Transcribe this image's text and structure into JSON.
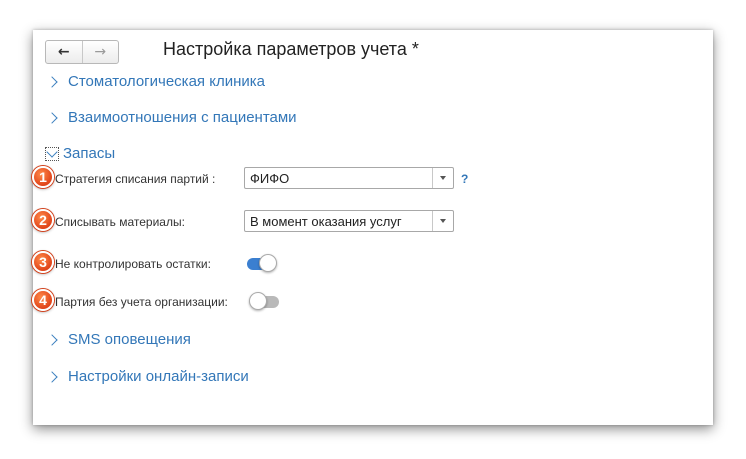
{
  "window": {
    "title": "Настройка параметров учета *"
  },
  "nav": {
    "back_icon": "←",
    "forward_icon": "→"
  },
  "groups": [
    {
      "label": "Стоматологическая клиника",
      "expanded": false
    },
    {
      "label": "Взаимоотношения с пациентами",
      "expanded": false
    },
    {
      "label": "Запасы",
      "expanded": true
    },
    {
      "label": "SMS оповещения",
      "expanded": false
    },
    {
      "label": "Настройки онлайн-записи",
      "expanded": false
    }
  ],
  "stock_settings": {
    "write_off_strategy": {
      "label": "Стратегия списания партий :",
      "value": "ФИФО",
      "help": "?"
    },
    "write_off_materials": {
      "label": "Списывать материалы:",
      "value": "В момент оказания услуг"
    },
    "no_stock_control": {
      "label": "Не контролировать остатки:",
      "enabled": true
    },
    "batch_without_org": {
      "label": "Партия без учета организации:",
      "enabled": false
    }
  },
  "badges": [
    "1",
    "2",
    "3",
    "4"
  ],
  "colors": {
    "link": "#3377b8",
    "toggle_on": "#3b7fd0",
    "toggle_off": "#b9b9b9",
    "badge": "#e0441a"
  }
}
